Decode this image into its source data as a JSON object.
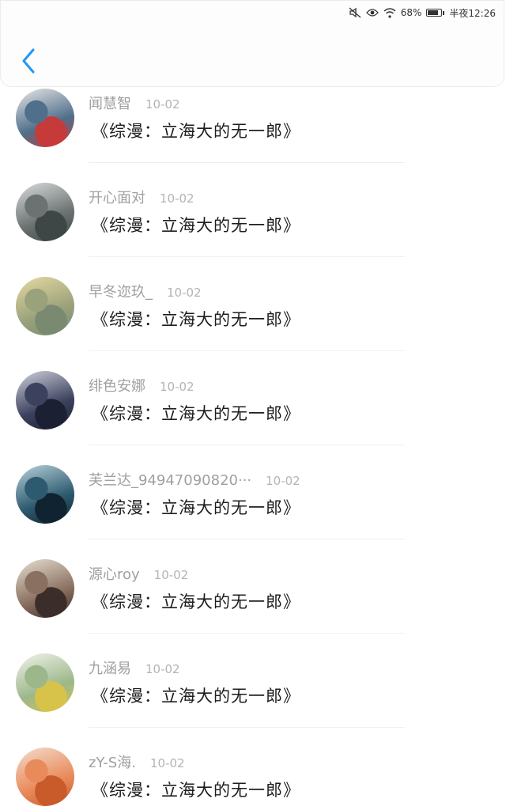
{
  "status_bar": {
    "battery_percent": "68%",
    "time": "半夜12:26",
    "icons": [
      "mute-icon",
      "eye-icon",
      "wifi-icon",
      "battery-icon"
    ]
  },
  "header": {
    "back_icon": "chevron-left-icon",
    "accent_color": "#2196f3"
  },
  "comments": [
    {
      "username": "闻慧智",
      "date": "10-02",
      "text": "《综漫：立海大的无一郎》",
      "avatar_colors": [
        "#e9e6e6",
        "#4f6f8a",
        "#c63a3a"
      ]
    },
    {
      "username": "开心面对",
      "date": "10-02",
      "text": "《综漫：立海大的无一郎》",
      "avatar_colors": [
        "#d9dcdc",
        "#6c7272",
        "#3f4646"
      ]
    },
    {
      "username": "早冬迩玖_",
      "date": "10-02",
      "text": "《综漫：立海大的无一郎》",
      "avatar_colors": [
        "#e6d9a2",
        "#9aa27b",
        "#7a8a70"
      ]
    },
    {
      "username": "绯色安娜",
      "date": "10-02",
      "text": "《综漫：立海大的无一郎》",
      "avatar_colors": [
        "#cfd2dc",
        "#3c425e",
        "#1c2033"
      ]
    },
    {
      "username": "芙兰达_94947090820···",
      "date": "10-02",
      "text": "《综漫：立海大的无一郎》",
      "avatar_colors": [
        "#b8d2dc",
        "#2d5a6e",
        "#0f2430"
      ]
    },
    {
      "username": "源心roy",
      "date": "10-02",
      "text": "《综漫：立海大的无一郎》",
      "avatar_colors": [
        "#e6dfd2",
        "#8a7060",
        "#3b2e2a"
      ]
    },
    {
      "username": "九涵易",
      "date": "10-02",
      "text": "《综漫：立海大的无一郎》",
      "avatar_colors": [
        "#f2f3ec",
        "#9cb88a",
        "#d8c34a"
      ]
    },
    {
      "username": "zY-S海.",
      "date": "10-02",
      "text": "《综漫：立海大的无一郎》",
      "avatar_colors": [
        "#f3ddcf",
        "#e98a5a",
        "#c95a2a"
      ]
    }
  ]
}
